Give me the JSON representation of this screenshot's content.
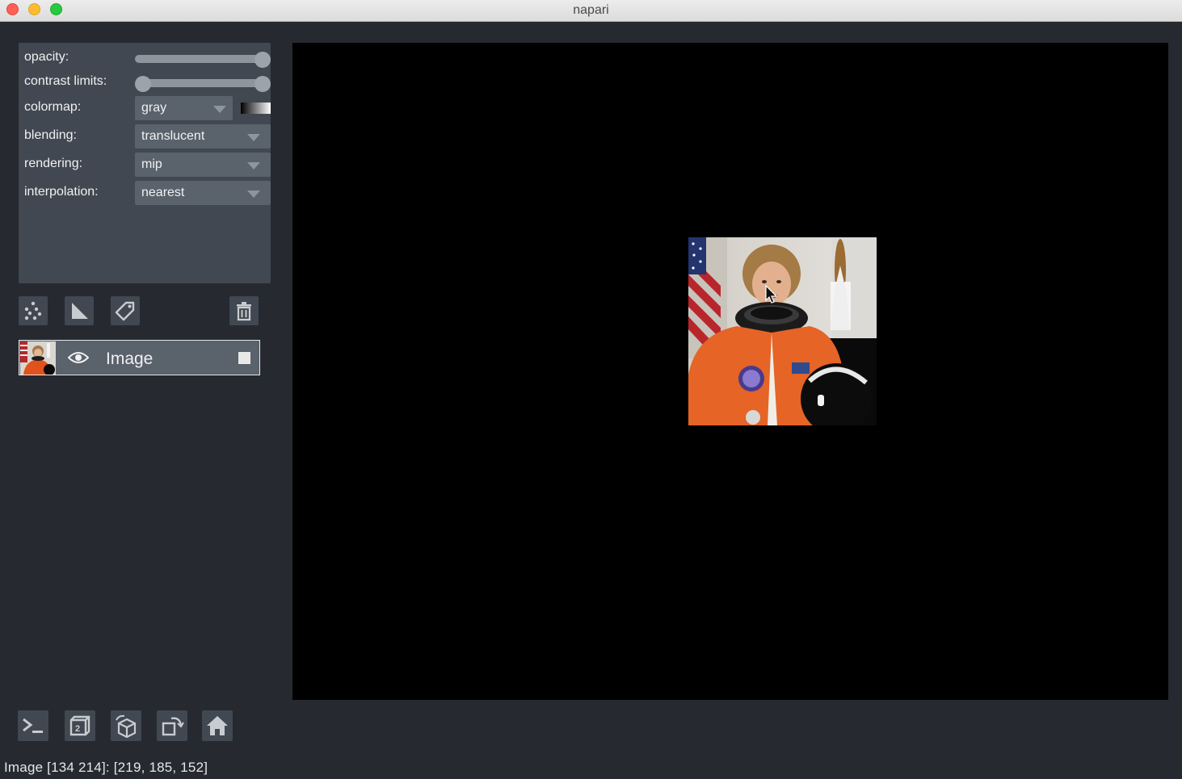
{
  "window": {
    "title": "napari"
  },
  "controls": {
    "opacity": {
      "label": "opacity:",
      "value": 1.0
    },
    "contrast_limits": {
      "label": "contrast limits:",
      "low": 0.0,
      "high": 1.0
    },
    "colormap": {
      "label": "colormap:",
      "value": "gray"
    },
    "blending": {
      "label": "blending:",
      "value": "translucent"
    },
    "rendering": {
      "label": "rendering:",
      "value": "mip"
    },
    "interpolation": {
      "label": "interpolation:",
      "value": "nearest"
    }
  },
  "layer_tools": {
    "icons": [
      "new-points-icon",
      "new-shapes-icon",
      "new-labels-icon",
      "delete-layer-icon"
    ]
  },
  "layers": [
    {
      "name": "Image",
      "visible": true
    }
  ],
  "viewer_buttons": {
    "icons": [
      "console-icon",
      "ndisplay-icon",
      "roll-icon",
      "transpose-icon",
      "home-icon"
    ]
  },
  "status": {
    "text": "Image [134 214]: [219, 185, 152]"
  },
  "colors": {
    "background": "#262930",
    "panel": "#414851",
    "widget": "#5a626c",
    "canvas": "#000000"
  }
}
